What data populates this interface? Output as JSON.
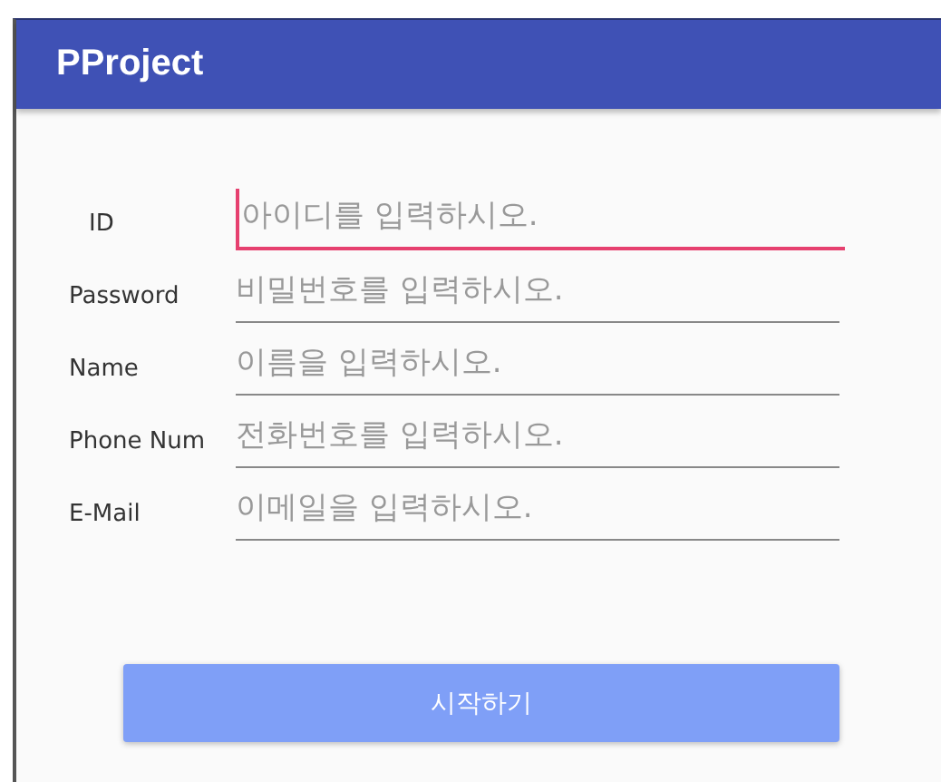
{
  "app_bar": {
    "title": "PProject"
  },
  "fields": [
    {
      "label": "ID",
      "placeholder": "아이디를 입력하시오.",
      "focused": true
    },
    {
      "label": "Password",
      "placeholder": "비밀번호를 입력하시오.",
      "focused": false
    },
    {
      "label": "Name",
      "placeholder": "이름을 입력하시오.",
      "focused": false
    },
    {
      "label": "Phone Num",
      "placeholder": "전화번호를 입력하시오.",
      "focused": false
    },
    {
      "label": "E-Mail",
      "placeholder": "이메일을 입력하시오.",
      "focused": false
    }
  ],
  "button": {
    "label": "시작하기"
  }
}
